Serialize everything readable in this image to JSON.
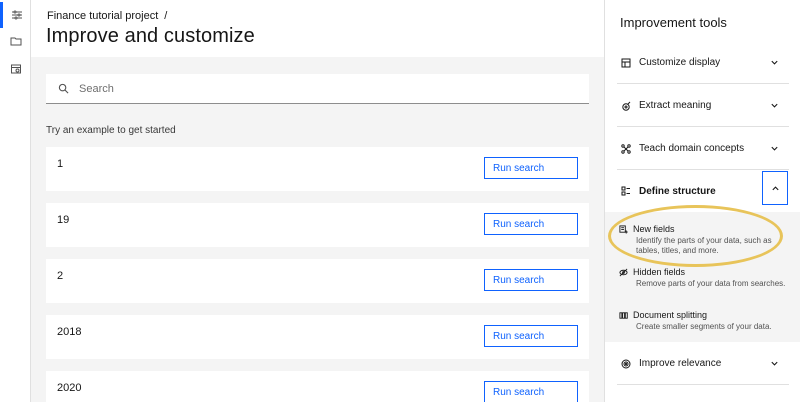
{
  "header": {
    "breadcrumb": "Finance tutorial project",
    "breadcrumb_sep": "/",
    "title": "Improve and customize"
  },
  "rail": {
    "items": [
      {
        "icon": "list-settings-icon",
        "active": true
      },
      {
        "icon": "folder-icon",
        "active": false
      },
      {
        "icon": "calendar-settings-icon",
        "active": false
      }
    ]
  },
  "search": {
    "placeholder": "Search",
    "value": ""
  },
  "examples": {
    "label": "Try an example to get started",
    "items": [
      {
        "text": "1",
        "button": "Run search"
      },
      {
        "text": "19",
        "button": "Run search"
      },
      {
        "text": "2",
        "button": "Run search"
      },
      {
        "text": "2018",
        "button": "Run search"
      },
      {
        "text": "2020",
        "button": "Run search"
      }
    ]
  },
  "panel": {
    "title": "Improvement tools",
    "tools": [
      {
        "label": "Customize display",
        "icon": "layout-icon"
      },
      {
        "label": "Extract meaning",
        "icon": "extract-icon"
      },
      {
        "label": "Teach domain concepts",
        "icon": "concepts-icon"
      },
      {
        "label": "Define structure",
        "icon": "structure-icon"
      },
      {
        "label": "Improve relevance",
        "icon": "relevance-icon"
      }
    ],
    "subitems": [
      {
        "title": "New fields",
        "desc": "Identify the parts of your data, such as tables, titles, and more.",
        "icon": "new-fields-icon"
      },
      {
        "title": "Hidden fields",
        "desc": "Remove parts of your data from searches.",
        "icon": "hidden-icon"
      },
      {
        "title": "Document splitting",
        "desc": "Create smaller segments of your data.",
        "icon": "split-icon"
      }
    ]
  },
  "colors": {
    "accent": "#0f62fe",
    "highlight": "#e8c45a",
    "background": "#f4f4f4"
  }
}
